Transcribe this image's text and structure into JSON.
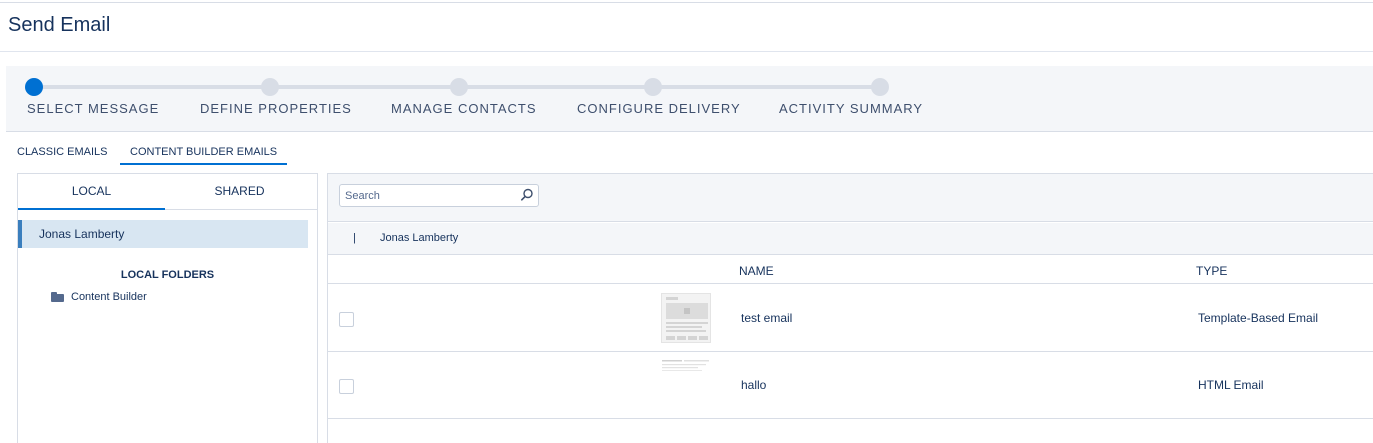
{
  "page": {
    "title": "Send Email"
  },
  "stepper": {
    "steps": [
      {
        "label": "SELECT MESSAGE",
        "active": true
      },
      {
        "label": "DEFINE PROPERTIES",
        "active": false
      },
      {
        "label": "MANAGE CONTACTS",
        "active": false
      },
      {
        "label": "CONFIGURE DELIVERY",
        "active": false
      },
      {
        "label": "ACTIVITY SUMMARY",
        "active": false
      }
    ]
  },
  "email_tabs": {
    "classic": "CLASSIC EMAILS",
    "content_builder": "CONTENT BUILDER EMAILS",
    "selected": "CONTENT BUILDER EMAILS"
  },
  "left_panel": {
    "tabs": {
      "local": "LOCAL",
      "shared": "SHARED",
      "selected": "LOCAL"
    },
    "user": "Jonas Lamberty",
    "folders_heading": "LOCAL FOLDERS",
    "folder": "Content Builder"
  },
  "right_panel": {
    "search": {
      "placeholder": "Search",
      "value": ""
    },
    "breadcrumb": {
      "separator": "|",
      "text": "Jonas Lamberty"
    },
    "columns": {
      "name": "NAME",
      "type": "TYPE"
    },
    "rows": [
      {
        "name": "test email",
        "type": "Template-Based Email"
      },
      {
        "name": "hallo",
        "type": "HTML Email"
      }
    ]
  },
  "colors": {
    "accent": "#0070d2",
    "text": "#16325c",
    "border": "#d8dde6",
    "selected_bg": "#d8e6f2"
  },
  "icons": {
    "search": "search-icon",
    "folder": "folder-icon"
  }
}
